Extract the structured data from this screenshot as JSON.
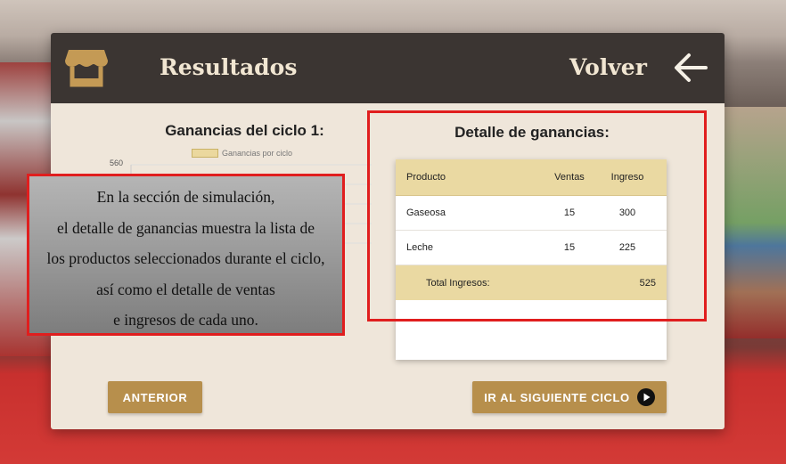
{
  "header": {
    "title": "Resultados",
    "back_label": "Volver",
    "store_icon": "store-icon",
    "back_icon": "arrow-left-icon"
  },
  "chart": {
    "title": "Ganancias del ciclo 1:",
    "legend": "Ganancias por ciclo",
    "ytick_top": "560"
  },
  "detail": {
    "title": "Detalle de ganancias:",
    "columns": [
      "Producto",
      "Ventas",
      "Ingreso"
    ],
    "rows": [
      {
        "producto": "Gaseosa",
        "ventas": "15",
        "ingreso": "300"
      },
      {
        "producto": "Leche",
        "ventas": "15",
        "ingreso": "225"
      }
    ],
    "total_label": "Total Ingresos:",
    "total_value": "525"
  },
  "buttons": {
    "prev": "ANTERIOR",
    "next": "IR AL SIGUIENTE CICLO"
  },
  "annotation": {
    "lines": [
      "En la sección de simulación,",
      "el detalle de ganancias muestra la lista de",
      "los productos seleccionados durante el ciclo,",
      "así como el detalle de ventas",
      "e ingresos de cada uno."
    ]
  },
  "colors": {
    "header_bg": "#3b3532",
    "panel_bg": "#efe6da",
    "accent_gold": "#b78f4c",
    "table_header": "#ead9a2",
    "highlight_red": "#e01e1e"
  }
}
